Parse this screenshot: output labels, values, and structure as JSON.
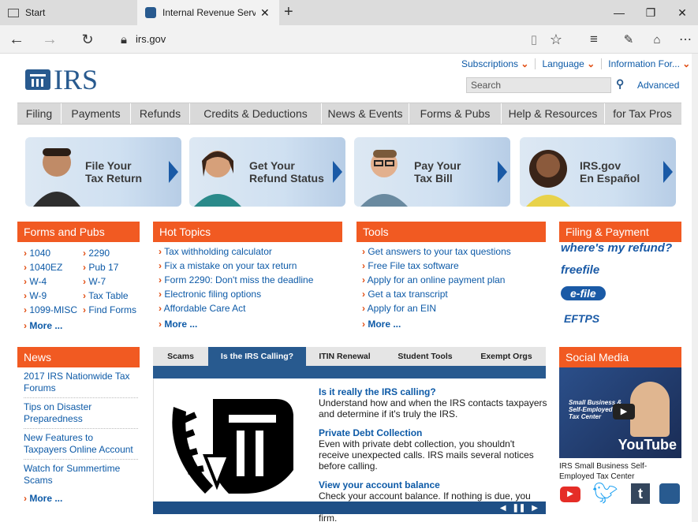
{
  "browser": {
    "tabs": [
      {
        "label": "Start"
      },
      {
        "label": "Internal Revenue Servic"
      }
    ],
    "address": "irs.gov"
  },
  "header": {
    "logo_text": "IRS",
    "links": [
      "Subscriptions",
      "Language",
      "Information For..."
    ],
    "search_placeholder": "Search",
    "advanced": "Advanced"
  },
  "nav": [
    "Filing",
    "Payments",
    "Refunds",
    "Credits & Deductions",
    "News & Events",
    "Forms & Pubs",
    "Help & Resources",
    "for Tax Pros"
  ],
  "banners": [
    {
      "line1": "File Your",
      "line2": "Tax Return"
    },
    {
      "line1": "Get Your",
      "line2": "Refund Status"
    },
    {
      "line1": "Pay Your",
      "line2": "Tax Bill"
    },
    {
      "line1": "IRS.gov",
      "line2": "En Español"
    }
  ],
  "forms_pubs": {
    "title": "Forms and Pubs",
    "col1": [
      "1040",
      "1040EZ",
      "W-4",
      "W-9",
      "1099-MISC"
    ],
    "col2": [
      "2290",
      "Pub 17",
      "W-7",
      "Tax Table",
      "Find Forms"
    ],
    "more": "More ..."
  },
  "hot_topics": {
    "title": "Hot Topics",
    "items": [
      "Tax withholding calculator",
      "Fix a mistake on your tax return",
      "Form 2290: Don't miss the deadline",
      "Electronic filing options",
      "Affordable Care Act"
    ],
    "more": "More ..."
  },
  "tools": {
    "title": "Tools",
    "items": [
      "Get answers to your tax questions",
      "Free File tax software",
      "Apply for an online payment plan",
      "Get a tax transcript",
      "Apply for an EIN"
    ],
    "more": "More ..."
  },
  "filing_payment": {
    "title": "Filing & Payment",
    "logos": [
      "where's my refund?",
      "freefile",
      "e-file",
      "EFTPS"
    ]
  },
  "news": {
    "title": "News",
    "items": [
      "2017 IRS Nationwide Tax Forums",
      "Tips on Disaster Preparedness",
      "New Features to Taxpayers Online Account",
      "Watch for Summertime Scams"
    ],
    "more": "More ..."
  },
  "carousel": {
    "tabs": [
      "Scams",
      "Is the IRS Calling?",
      "ITIN Renewal",
      "Student Tools",
      "Exempt Orgs"
    ],
    "active_tab": "Is the IRS Calling?",
    "articles": [
      {
        "title": "Is it really the IRS calling?",
        "body": "Understand how and when the IRS contacts taxpayers and determine if it's truly the IRS."
      },
      {
        "title": "Private Debt Collection",
        "body": "Even with private debt collection, you shouldn't receive unexpected calls. IRS mails several notices before calling."
      },
      {
        "title": "View your account balance",
        "body": "Check your account balance. If nothing is due, you typically wouldn't be contacted by IRS or a private firm."
      }
    ]
  },
  "social": {
    "title": "Social Media",
    "video_caption": "IRS Small Business Self-Employed Tax Center",
    "video_overlay": "Small Business & Self-Employed Tax Center",
    "youtube": "YouTube"
  },
  "colors": {
    "accent": "#f15a22",
    "brand": "#285a8f",
    "link": "#0d5aa7"
  }
}
